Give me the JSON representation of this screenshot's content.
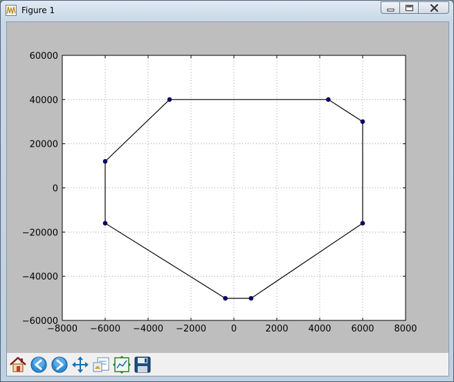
{
  "window": {
    "title": "Figure 1"
  },
  "caption_buttons": [
    "minimize-icon",
    "maximize-icon",
    "close-icon"
  ],
  "toolbar": {
    "buttons": [
      {
        "name": "home-icon"
      },
      {
        "name": "back-arrow-icon"
      },
      {
        "name": "forward-arrow-icon"
      },
      {
        "name": "pan-icon"
      },
      {
        "name": "zoom-rect-icon"
      },
      {
        "name": "subplots-icon"
      },
      {
        "name": "save-icon"
      }
    ]
  },
  "colors": {
    "figure_bg": "#bebebe",
    "axes_bg": "#ffffff",
    "line": "#000000",
    "marker": "#000080",
    "grid": "#888888"
  },
  "chart_data": {
    "type": "line",
    "title": "",
    "xlabel": "",
    "ylabel": "",
    "xlim": [
      -8000,
      8000
    ],
    "ylim": [
      -60000,
      60000
    ],
    "grid": true,
    "x_ticks": [
      -8000,
      -6000,
      -4000,
      -2000,
      0,
      2000,
      4000,
      6000,
      8000
    ],
    "y_ticks": [
      -60000,
      -40000,
      -20000,
      0,
      20000,
      40000,
      60000
    ],
    "x_tick_labels": [
      "−8000",
      "−6000",
      "−4000",
      "−2000",
      "0",
      "2000",
      "4000",
      "6000",
      "8000"
    ],
    "y_tick_labels": [
      "−60000",
      "−40000",
      "−20000",
      "0",
      "20000",
      "40000",
      "60000"
    ],
    "series": [
      {
        "closed": true,
        "marker": "circle",
        "points": [
          {
            "x": -3000,
            "y": 40000
          },
          {
            "x": 4400,
            "y": 40000
          },
          {
            "x": 6000,
            "y": 30000
          },
          {
            "x": 6000,
            "y": -16000
          },
          {
            "x": 800,
            "y": -50000
          },
          {
            "x": -400,
            "y": -50000
          },
          {
            "x": -6000,
            "y": -16000
          },
          {
            "x": -6000,
            "y": 12000
          }
        ]
      }
    ]
  }
}
